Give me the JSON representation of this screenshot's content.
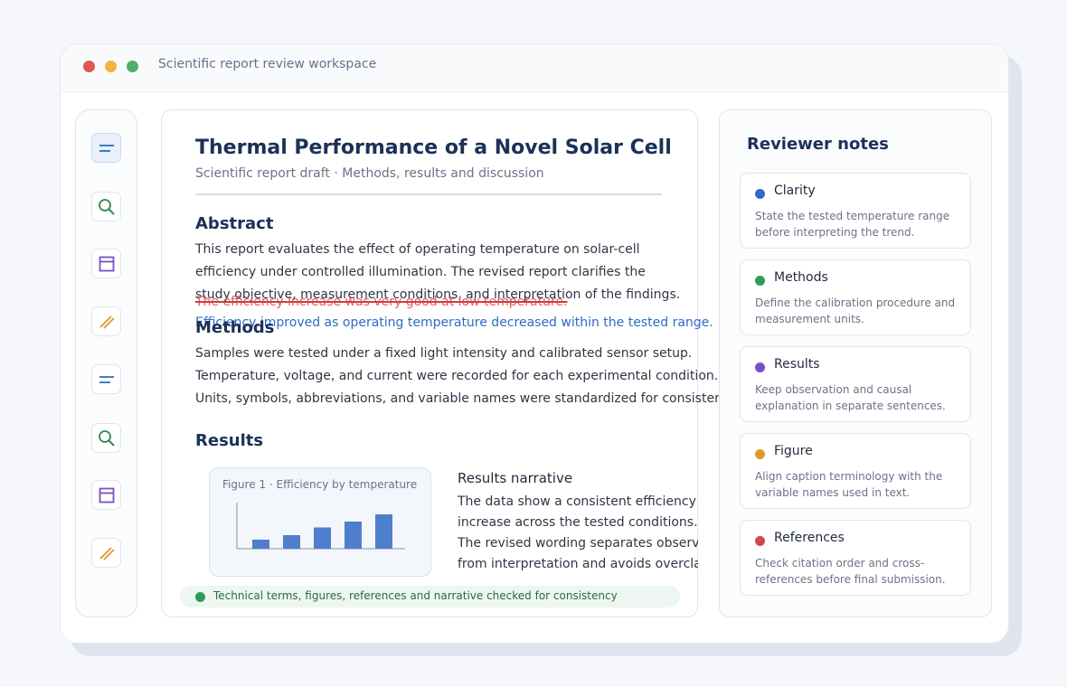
{
  "window": {
    "title": "Scientific report review workspace"
  },
  "rail": {
    "icons": [
      "lines-icon",
      "search-icon",
      "panel-icon",
      "pen-icon",
      "lines-icon",
      "search-icon",
      "panel-icon",
      "pen-icon"
    ]
  },
  "document": {
    "title": "Thermal Performance of a Novel Solar Cell",
    "subtitle": "Scientific report draft · Methods, results and discussion",
    "abstract": {
      "heading": "Abstract",
      "lines": [
        "This report evaluates the effect of operating temperature on solar-cell",
        "efficiency under controlled illumination. The revised report clarifies the",
        "study objective, measurement conditions, and interpretation of the findings."
      ],
      "deleted": "The efficiency increase was very good at low temperature.",
      "inserted": "Efficiency improved as operating temperature decreased within the tested range."
    },
    "methods": {
      "heading": "Methods",
      "lines": [
        "Samples were tested under a fixed light intensity and calibrated sensor setup.",
        "Temperature, voltage, and current were recorded for each experimental condition.",
        "Units, symbols, abbreviations, and variable names were standardized for consistency."
      ]
    },
    "results": {
      "heading": "Results",
      "figure_caption": "Figure 1 · Efficiency by temperature",
      "narrative_title": "Results narrative",
      "narrative_lines": [
        "The data show a consistent efficiency",
        "increase across the tested conditions.",
        "The revised wording separates observation",
        "from interpretation and avoids overclaiming."
      ]
    },
    "status": "Technical terms, figures, references and narrative checked for consistency"
  },
  "chart_data": {
    "type": "bar",
    "title": "Figure 1 · Efficiency by temperature",
    "values": [
      20,
      30,
      47,
      60,
      76
    ],
    "ylim": [
      0,
      100
    ],
    "color": "#4f7fcc"
  },
  "notes": {
    "title": "Reviewer notes",
    "items": [
      {
        "title": "Clarity",
        "color": "#2f6cc5",
        "lines": [
          "State the tested temperature range",
          "before interpreting the trend."
        ]
      },
      {
        "title": "Methods",
        "color": "#2f9a5c",
        "lines": [
          "Define the calibration procedure and",
          "measurement units."
        ]
      },
      {
        "title": "Results",
        "color": "#7a4fc2",
        "lines": [
          "Keep observation and causal",
          "explanation in separate sentences."
        ]
      },
      {
        "title": "Figure",
        "color": "#e0962a",
        "lines": [
          "Align caption terminology with the",
          "variable names used in text."
        ]
      },
      {
        "title": "References",
        "color": "#d14848",
        "lines": [
          "Check citation order and cross-",
          "references before final submission."
        ]
      }
    ]
  },
  "colors": {
    "heading": "#1b3157",
    "accent_blue": "#2f6cc5",
    "deleted_red": "#e06060",
    "status_green": "#2f9a5c"
  }
}
